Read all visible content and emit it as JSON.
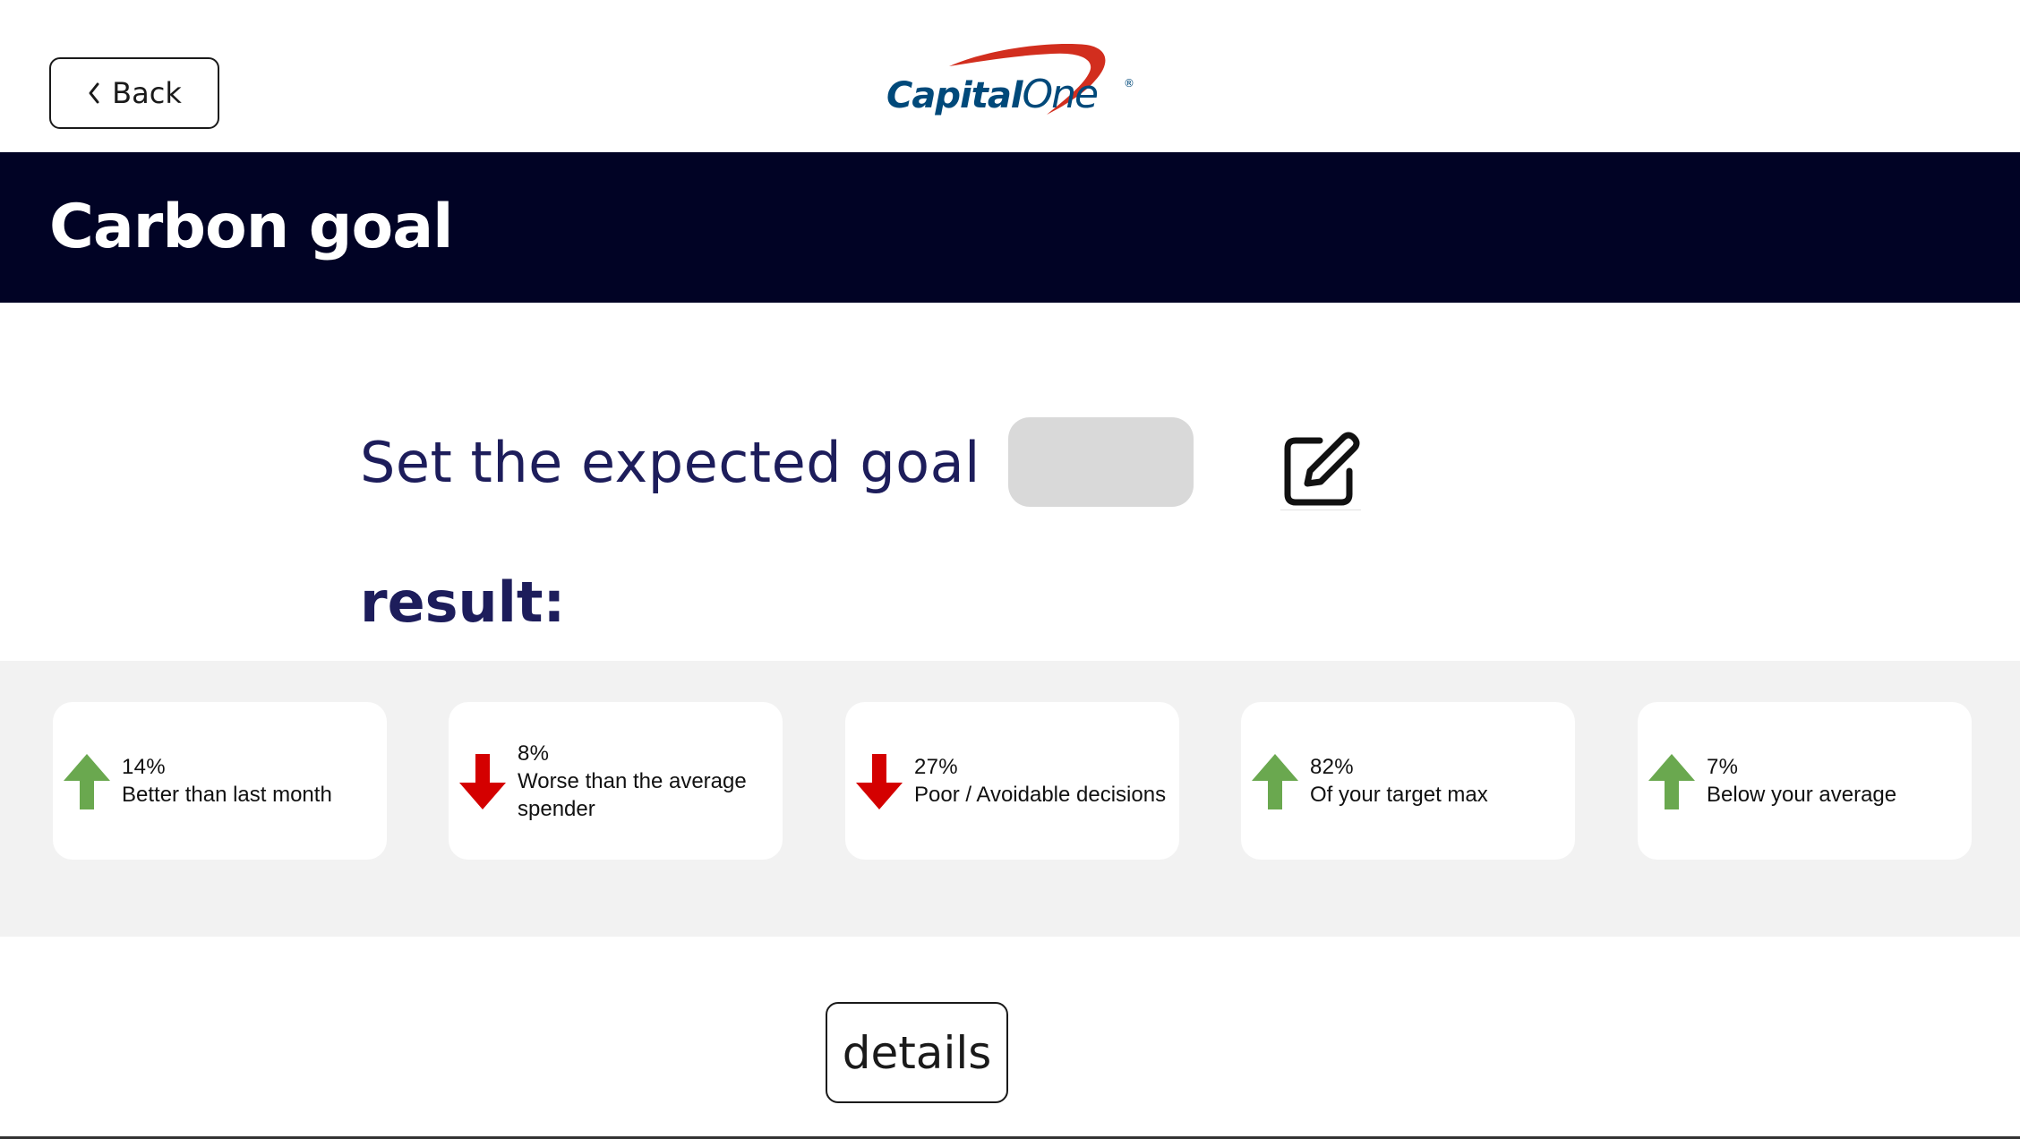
{
  "nav": {
    "back_label": "Back"
  },
  "brand": {
    "logo_part_a": "Capital",
    "logo_part_b": "One",
    "logo_registered": "®",
    "colors": {
      "logo_blue": "#00497a",
      "swoosh_red": "#d22e1e"
    }
  },
  "header": {
    "title": "Carbon goal",
    "band_color": "#010325"
  },
  "goal": {
    "label": "Set the expected goal",
    "input_value": "",
    "input_placeholder": "",
    "edit_icon": "edit-icon"
  },
  "result": {
    "label": "result:",
    "stats": [
      {
        "value": "14%",
        "text": "Better than last month",
        "direction": "up",
        "icon": "arrow-up-icon"
      },
      {
        "value": "8%",
        "text": "Worse than the average spender",
        "direction": "down",
        "icon": "arrow-down-icon"
      },
      {
        "value": "27%",
        "text": "Poor / Avoidable decisions",
        "direction": "down",
        "icon": "arrow-down-icon"
      },
      {
        "value": "82%",
        "text": "Of your target max",
        "direction": "up",
        "icon": "arrow-up-icon"
      },
      {
        "value": "7%",
        "text": "Below your average",
        "direction": "up",
        "icon": "arrow-up-icon"
      }
    ],
    "colors": {
      "up": "#6aa84f",
      "down": "#d40000"
    }
  },
  "actions": {
    "details_label": "details"
  }
}
